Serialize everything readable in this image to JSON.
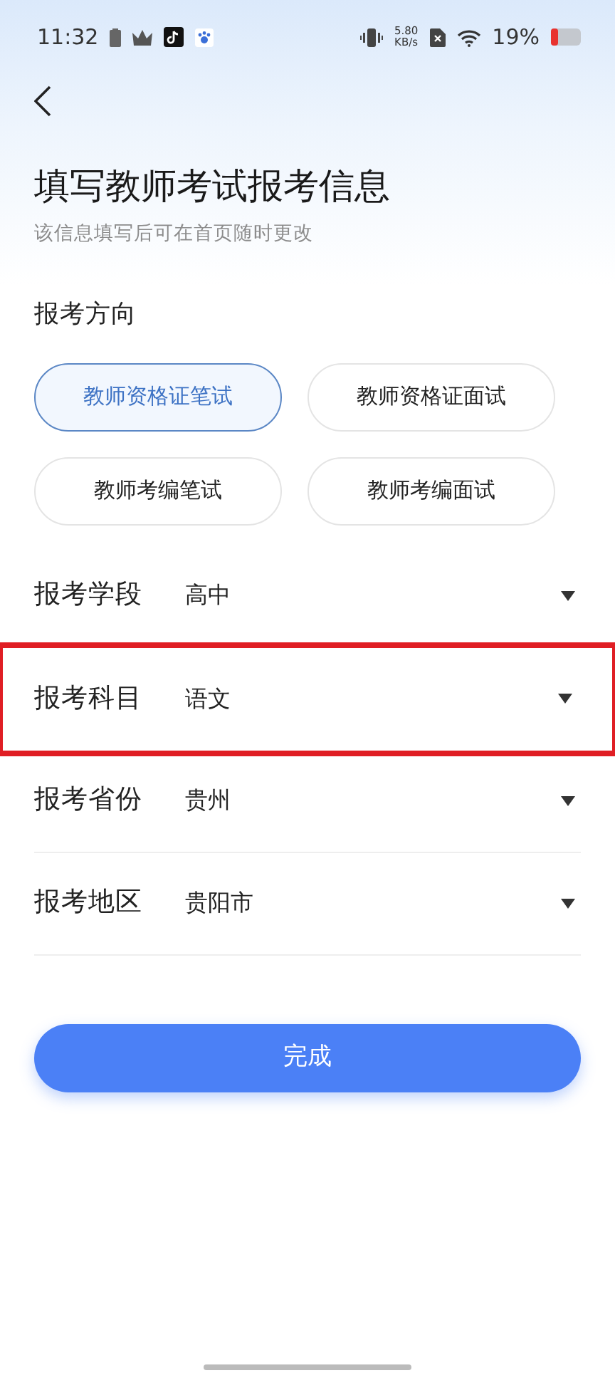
{
  "status_bar": {
    "time": "11:32",
    "speed_value": "5.80",
    "speed_unit": "KB/s",
    "battery": "19%"
  },
  "title": "填写教师考试报考信息",
  "subtitle": "该信息填写后可在首页随时更改",
  "direction": {
    "label": "报考方向",
    "options": [
      {
        "label": "教师资格证笔试",
        "selected": true
      },
      {
        "label": "教师资格证面试",
        "selected": false
      },
      {
        "label": "教师考编笔试",
        "selected": false
      },
      {
        "label": "教师考编面试",
        "selected": false
      }
    ]
  },
  "fields": [
    {
      "label": "报考学段",
      "value": "高中",
      "highlighted": false
    },
    {
      "label": "报考科目",
      "value": "语文",
      "highlighted": true
    },
    {
      "label": "报考省份",
      "value": "贵州",
      "highlighted": false
    },
    {
      "label": "报考地区",
      "value": "贵阳市",
      "highlighted": false
    }
  ],
  "submit": "完成"
}
